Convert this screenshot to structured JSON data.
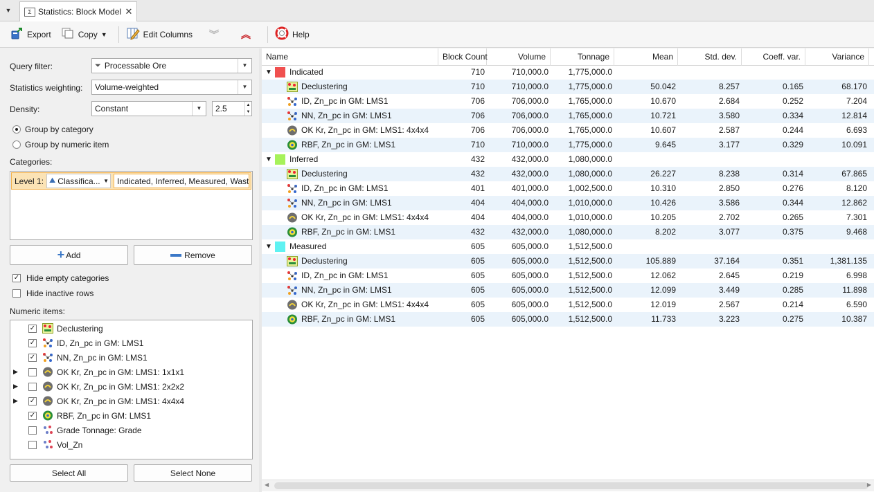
{
  "tab": {
    "title": "Statistics: Block Model",
    "close": "✕",
    "icon": "Σ"
  },
  "toolbar": {
    "export": "Export",
    "copy": "Copy",
    "edit_columns": "Edit Columns",
    "help": "Help"
  },
  "left": {
    "query_filter_label": "Query filter:",
    "query_filter_value": "Processable Ore",
    "weighting_label": "Statistics weighting:",
    "weighting_value": "Volume-weighted",
    "density_label": "Density:",
    "density_value": "Constant",
    "density_number": "2.5",
    "group_by_category": "Group by category",
    "group_by_numeric": "Group by numeric item",
    "categories_label": "Categories:",
    "category_level": "Level 1:",
    "category_column": "Classifica...",
    "category_values": "Indicated, Inferred, Measured, Waste",
    "add_button": "Add",
    "remove_button": "Remove",
    "hide_empty": "Hide empty categories",
    "hide_inactive": "Hide inactive rows",
    "numeric_items_label": "Numeric items:",
    "numeric_items": [
      {
        "label": "Declustering",
        "checked": true,
        "expandable": false,
        "icon": "declustering-icon"
      },
      {
        "label": "ID, Zn_pc in GM: LMS1",
        "checked": true,
        "expandable": false,
        "icon": "id-estimator-icon"
      },
      {
        "label": "NN, Zn_pc in GM: LMS1",
        "checked": true,
        "expandable": false,
        "icon": "nn-estimator-icon"
      },
      {
        "label": "OK Kr, Zn_pc in GM: LMS1: 1x1x1",
        "checked": false,
        "expandable": true,
        "icon": "kriging-icon"
      },
      {
        "label": "OK Kr, Zn_pc in GM: LMS1: 2x2x2",
        "checked": false,
        "expandable": true,
        "icon": "kriging-icon"
      },
      {
        "label": "OK Kr, Zn_pc in GM: LMS1: 4x4x4",
        "checked": true,
        "expandable": true,
        "icon": "kriging-icon"
      },
      {
        "label": "RBF, Zn_pc in GM: LMS1",
        "checked": true,
        "expandable": false,
        "icon": "rbf-icon"
      },
      {
        "label": "Grade Tonnage: Grade",
        "checked": false,
        "expandable": false,
        "icon": "calculation-icon"
      },
      {
        "label": "Vol_Zn",
        "checked": false,
        "expandable": false,
        "icon": "calculation-icon"
      }
    ],
    "select_all": "Select All",
    "select_none": "Select None"
  },
  "table": {
    "columns": [
      "Name",
      "Block Count",
      "Volume",
      "Tonnage",
      "Mean",
      "Std. dev.",
      "Coeff. var.",
      "Variance"
    ],
    "groups": [
      {
        "name": "Indicated",
        "color": "#f0504f",
        "block_count": "710",
        "volume": "710,000.0",
        "tonnage": "1,775,000.0",
        "rows": [
          {
            "name": "Declustering",
            "icon": "declustering-icon",
            "vals": [
              "710",
              "710,000.0",
              "1,775,000.0",
              "50.042",
              "8.257",
              "0.165",
              "68.170"
            ]
          },
          {
            "name": "ID, Zn_pc in GM: LMS1",
            "icon": "id-estimator-icon",
            "vals": [
              "706",
              "706,000.0",
              "1,765,000.0",
              "10.670",
              "2.684",
              "0.252",
              "7.204"
            ]
          },
          {
            "name": "NN, Zn_pc in GM: LMS1",
            "icon": "nn-estimator-icon",
            "vals": [
              "706",
              "706,000.0",
              "1,765,000.0",
              "10.721",
              "3.580",
              "0.334",
              "12.814"
            ]
          },
          {
            "name": "OK Kr, Zn_pc in GM: LMS1: 4x4x4",
            "icon": "kriging-icon",
            "vals": [
              "706",
              "706,000.0",
              "1,765,000.0",
              "10.607",
              "2.587",
              "0.244",
              "6.693"
            ]
          },
          {
            "name": "RBF, Zn_pc in GM: LMS1",
            "icon": "rbf-icon",
            "vals": [
              "710",
              "710,000.0",
              "1,775,000.0",
              "9.645",
              "3.177",
              "0.329",
              "10.091"
            ]
          }
        ]
      },
      {
        "name": "Inferred",
        "color": "#a6f25a",
        "block_count": "432",
        "volume": "432,000.0",
        "tonnage": "1,080,000.0",
        "rows": [
          {
            "name": "Declustering",
            "icon": "declustering-icon",
            "vals": [
              "432",
              "432,000.0",
              "1,080,000.0",
              "26.227",
              "8.238",
              "0.314",
              "67.865"
            ]
          },
          {
            "name": "ID, Zn_pc in GM: LMS1",
            "icon": "id-estimator-icon",
            "vals": [
              "401",
              "401,000.0",
              "1,002,500.0",
              "10.310",
              "2.850",
              "0.276",
              "8.120"
            ]
          },
          {
            "name": "NN, Zn_pc in GM: LMS1",
            "icon": "nn-estimator-icon",
            "vals": [
              "404",
              "404,000.0",
              "1,010,000.0",
              "10.426",
              "3.586",
              "0.344",
              "12.862"
            ]
          },
          {
            "name": "OK Kr, Zn_pc in GM: LMS1: 4x4x4",
            "icon": "kriging-icon",
            "vals": [
              "404",
              "404,000.0",
              "1,010,000.0",
              "10.205",
              "2.702",
              "0.265",
              "7.301"
            ]
          },
          {
            "name": "RBF, Zn_pc in GM: LMS1",
            "icon": "rbf-icon",
            "vals": [
              "432",
              "432,000.0",
              "1,080,000.0",
              "8.202",
              "3.077",
              "0.375",
              "9.468"
            ]
          }
        ]
      },
      {
        "name": "Measured",
        "color": "#5ff2f2",
        "block_count": "605",
        "volume": "605,000.0",
        "tonnage": "1,512,500.0",
        "rows": [
          {
            "name": "Declustering",
            "icon": "declustering-icon",
            "vals": [
              "605",
              "605,000.0",
              "1,512,500.0",
              "105.889",
              "37.164",
              "0.351",
              "1,381.135"
            ]
          },
          {
            "name": "ID, Zn_pc in GM: LMS1",
            "icon": "id-estimator-icon",
            "vals": [
              "605",
              "605,000.0",
              "1,512,500.0",
              "12.062",
              "2.645",
              "0.219",
              "6.998"
            ]
          },
          {
            "name": "NN, Zn_pc in GM: LMS1",
            "icon": "nn-estimator-icon",
            "vals": [
              "605",
              "605,000.0",
              "1,512,500.0",
              "12.099",
              "3.449",
              "0.285",
              "11.898"
            ]
          },
          {
            "name": "OK Kr, Zn_pc in GM: LMS1: 4x4x4",
            "icon": "kriging-icon",
            "vals": [
              "605",
              "605,000.0",
              "1,512,500.0",
              "12.019",
              "2.567",
              "0.214",
              "6.590"
            ]
          },
          {
            "name": "RBF, Zn_pc in GM: LMS1",
            "icon": "rbf-icon",
            "vals": [
              "605",
              "605,000.0",
              "1,512,500.0",
              "11.733",
              "3.223",
              "0.275",
              "10.387"
            ]
          }
        ]
      }
    ]
  }
}
